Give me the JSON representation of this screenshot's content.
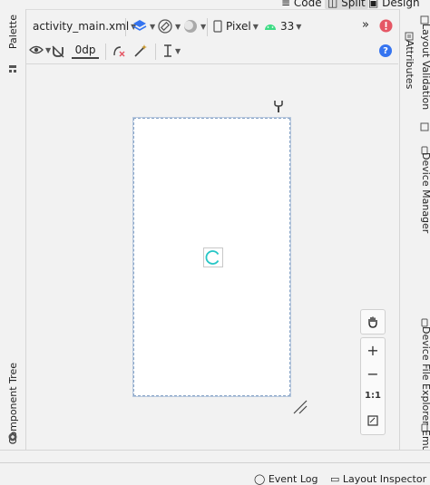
{
  "view_modes": {
    "code": "Code",
    "split": "Split",
    "design": "Design"
  },
  "left_stripe": {
    "palette": "Palette",
    "component_tree": "Component Tree"
  },
  "right_stripe": {
    "attributes": "Attributes",
    "layout_validation": "Layout Validation",
    "device_manager": "Device Manager",
    "device_file_explorer": "Device File Explorer",
    "emulator": "Emulator"
  },
  "toolbar": {
    "file_name": "activity_main.xml",
    "device": "Pixel",
    "api_level": "33",
    "more": "»",
    "margin_value": "0dp",
    "help": "?"
  },
  "zoom": {
    "zoom_in": "+",
    "zoom_out": "−",
    "actual_size": "1:1"
  },
  "status_bar": {
    "event_log": "Event Log",
    "layout_inspector": "Layout Inspector"
  },
  "colors": {
    "accent": "#3574f0",
    "android_green": "#3ddc84",
    "error_red": "#e55765",
    "progress_teal": "#26c6c6"
  }
}
